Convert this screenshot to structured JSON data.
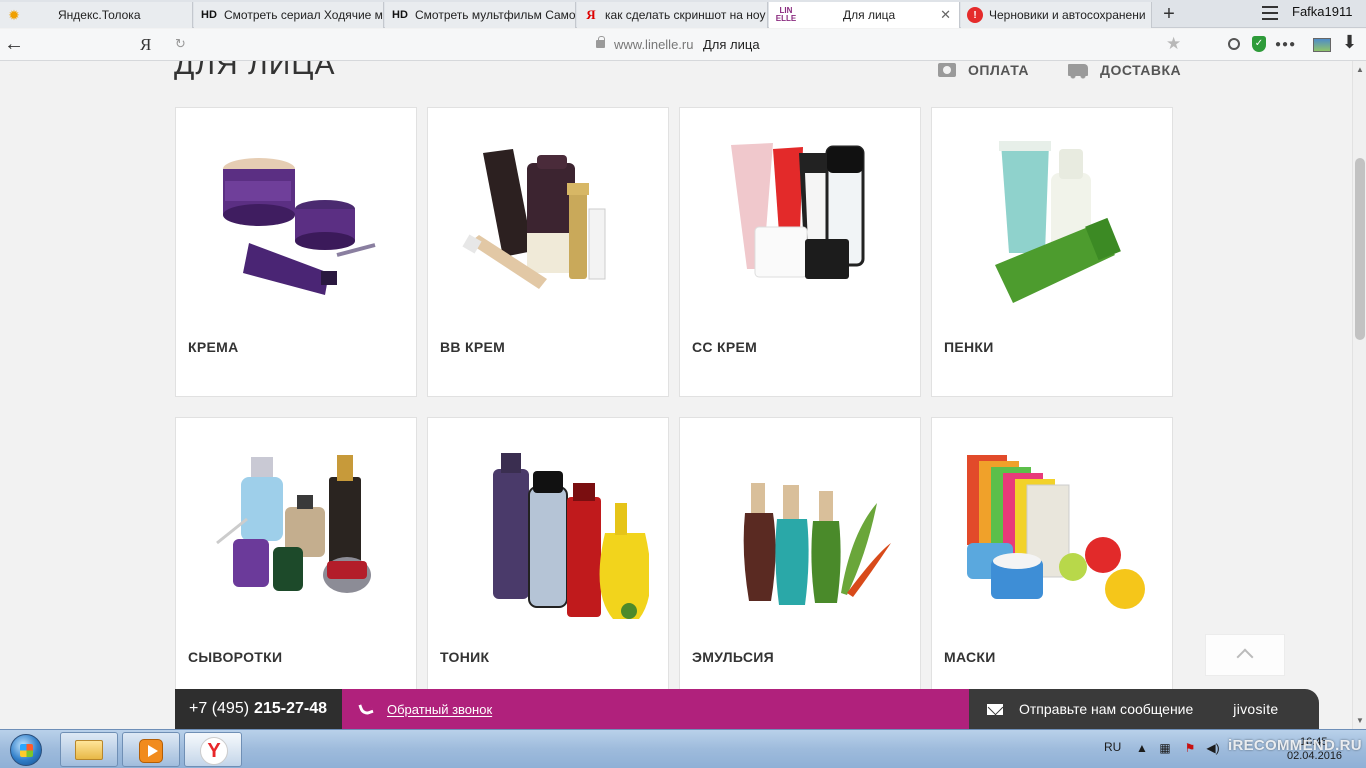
{
  "browser": {
    "tabs": [
      {
        "label": "Яндекс.Толока",
        "icon": "toloka-favicon-icon"
      },
      {
        "label": "Смотреть сериал Ходячие м",
        "icon": "hd-favicon-icon"
      },
      {
        "label": "Смотреть мультфильм Само",
        "icon": "hd-favicon-icon"
      },
      {
        "label": "как сделать скриншот на ноу",
        "icon": "yandex-favicon-icon"
      },
      {
        "label": "Для лица",
        "icon": "linelle-favicon-icon",
        "active": true
      },
      {
        "label": "Черновики и автосохранени",
        "icon": "otzovik-favicon-icon"
      }
    ],
    "favicon_text": {
      "hd": "HD",
      "yandex": "Я",
      "linelle_top": "LIN",
      "linelle_bottom": "ELLE",
      "otzovik": "!"
    },
    "user_name": "Fafka1911",
    "address": {
      "host": "www.linelle.ru",
      "page_title": "Для лица",
      "yandex_button": "Я"
    }
  },
  "page": {
    "title": "ДЛЯ ЛИЦА",
    "links": {
      "payment": "ОПЛАТА",
      "delivery": "ДОСТАВКА"
    },
    "categories": [
      {
        "label": "КРЕМА"
      },
      {
        "label": "ВВ КРЕМ"
      },
      {
        "label": "СС КРЕМ"
      },
      {
        "label": "ПЕНКИ"
      },
      {
        "label": "СЫВОРОТКИ"
      },
      {
        "label": "ТОНИК"
      },
      {
        "label": "ЭМУЛЬСИЯ"
      },
      {
        "label": "МАСКИ"
      }
    ],
    "bottom_bar": {
      "phone_prefix": "+7 (495)",
      "phone_number": "215-27-48",
      "callback_label": "Обратный звонок",
      "chat_label": "Отправьте нам сообщение",
      "chat_brand": "jivosite"
    },
    "colors": {
      "callback_bar": "#b0217c",
      "phone_bar": "#2e2e2e",
      "chat_bar": "#3a3a3a"
    }
  },
  "taskbar": {
    "language": "RU",
    "time": "16:45",
    "date": "02.04.2016",
    "watermark": "iRECOMMEND.RU"
  }
}
